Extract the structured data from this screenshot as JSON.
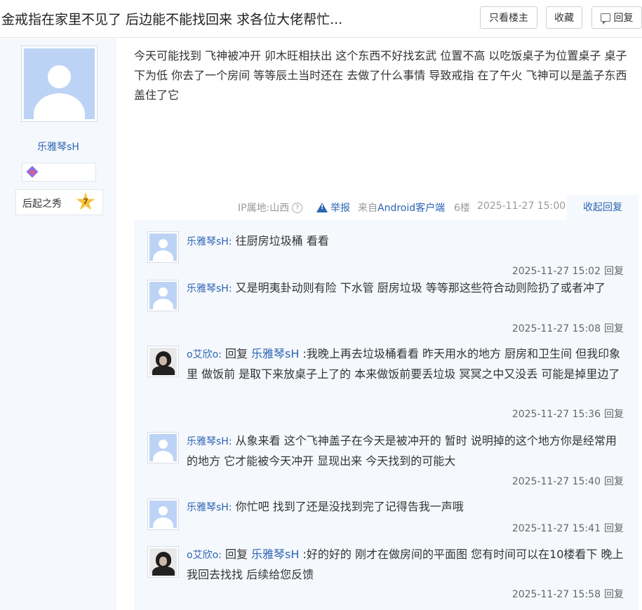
{
  "header": {
    "title": "金戒指在家里不见了 后边能不能找回来 求各位大佬帮忙...",
    "only_op_label": "只看楼主",
    "collect_label": "收藏",
    "reply_label": "回复"
  },
  "author": {
    "name": "乐雅琴sH",
    "rank_title": "后起之秀",
    "level": "7"
  },
  "post": {
    "content": "今天可能找到 飞神被冲开 卯木旺相扶出 这个东西不好找玄武 位置不高 以吃饭桌子为位置桌子 桌子下为低 你去了一个房间 等等辰土当时还在 去做了什么事情 导致戒指 在了午火 飞神可以是盖子东西盖住了它",
    "ip_label": "IP属地:山西",
    "report_label": "举报",
    "source_prefix": "来自",
    "source_client": "Android客户端",
    "floor": "6楼",
    "time": "2025-11-27 15:00",
    "collapse_label": "收起回复"
  },
  "replies": [
    {
      "user": "乐雅琴sH:",
      "prefix": "",
      "target": "",
      "text": " 往厨房垃圾桶 看看",
      "time": "2025-11-27 15:02",
      "reply_label": "回复",
      "avatar": "default-avatar"
    },
    {
      "user": "乐雅琴sH:",
      "prefix": "",
      "target": "",
      "text": " 又是明夷卦动则有险 下水管 厨房垃圾 等等那这些符合动则险扔了或者冲了",
      "time": "2025-11-27 15:08",
      "reply_label": "回复",
      "avatar": "default-avatar"
    },
    {
      "user": "o艾欣o:",
      "prefix": " 回复 ",
      "target": "乐雅琴sH",
      "text": " :我晚上再去垃圾桶看看 昨天用水的地方 厨房和卫生间 但我印象里 做饭前 是取下来放桌子上了的 本来做饭前要丢垃圾 冥冥之中又没丢 可能是掉里边了",
      "time": "2025-11-27 15:36",
      "reply_label": "回复",
      "avatar": "photo-avatar"
    },
    {
      "user": "乐雅琴sH:",
      "prefix": "",
      "target": "",
      "text": " 从象来看 这个飞神盖子在今天是被冲开的 暂时 说明掉的这个地方你是经常用的地方 它才能被今天冲开 显现出来 今天找到的可能大",
      "time": "2025-11-27 15:40",
      "reply_label": "回复",
      "avatar": "default-avatar"
    },
    {
      "user": "乐雅琴sH:",
      "prefix": "",
      "target": "",
      "text": " 你忙吧 找到了还是没找到完了记得告我一声哦",
      "time": "2025-11-27 15:41",
      "reply_label": "回复",
      "avatar": "default-avatar"
    },
    {
      "user": "o艾欣o:",
      "prefix": " 回复 ",
      "target": "乐雅琴sH",
      "text": " :好的好的 刚才在做房间的平面图 您有时间可以在10楼看下 晚上我回去找找 后续给您反馈",
      "time": "2025-11-27 15:58",
      "reply_label": "回复",
      "avatar": "photo-avatar"
    }
  ]
}
